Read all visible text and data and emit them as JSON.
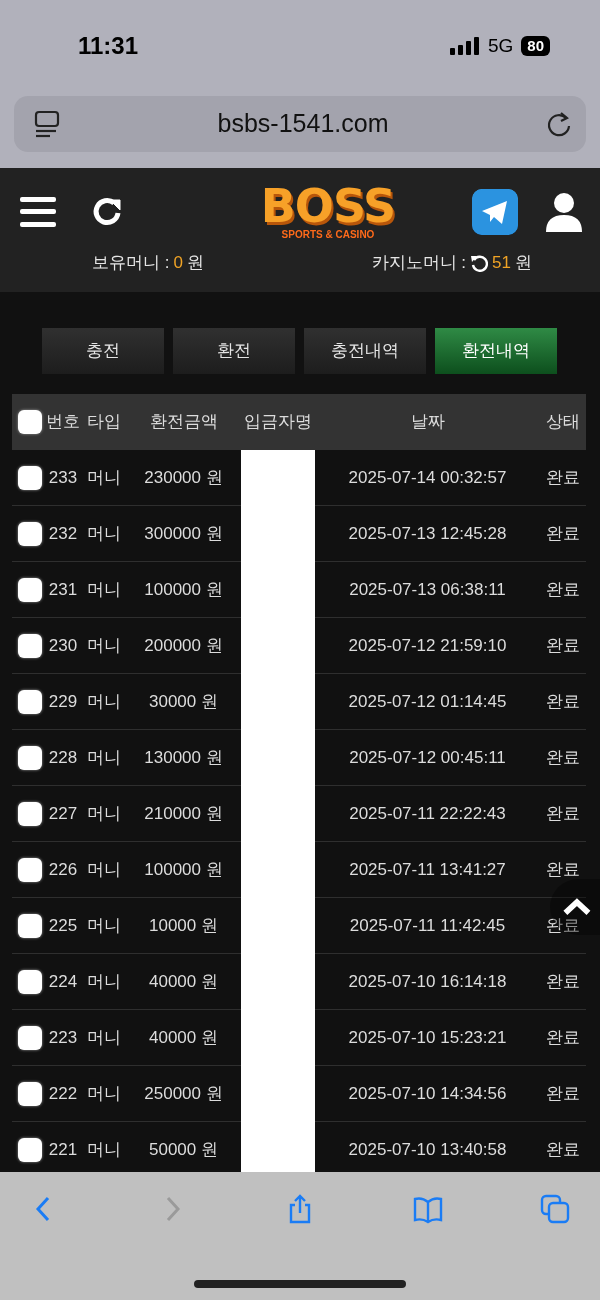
{
  "status_bar": {
    "time": "11:31",
    "network": "5G",
    "battery": "80"
  },
  "browser": {
    "url": "bsbs-1541.com"
  },
  "header": {
    "logo": {
      "title": "BOSS",
      "subtitle": "SPORTS & CASINO"
    },
    "balances": [
      {
        "label": "보유머니 :",
        "amount": "0",
        "unit": "원",
        "refresh": false
      },
      {
        "label": "카지노머니 :",
        "amount": "51",
        "unit": "원",
        "refresh": true
      }
    ]
  },
  "tabs": [
    {
      "label": "충전",
      "selected": false
    },
    {
      "label": "환전",
      "selected": false
    },
    {
      "label": "충전내역",
      "selected": false
    },
    {
      "label": "환전내역",
      "selected": true
    }
  ],
  "table": {
    "header_checkbox": {
      "checked": false
    },
    "columns": [
      "번호",
      "타입",
      "환전금액",
      "입금자명",
      "날짜",
      "상태"
    ],
    "rows": [
      {
        "checked": false,
        "number": "233",
        "type": "머니",
        "amount": "230000 원",
        "date": "2025-07-14 00:32:57",
        "status": "완료"
      },
      {
        "checked": false,
        "number": "232",
        "type": "머니",
        "amount": "300000 원",
        "date": "2025-07-13 12:45:28",
        "status": "완료"
      },
      {
        "checked": false,
        "number": "231",
        "type": "머니",
        "amount": "100000 원",
        "date": "2025-07-13 06:38:11",
        "status": "완료"
      },
      {
        "checked": false,
        "number": "230",
        "type": "머니",
        "amount": "200000 원",
        "date": "2025-07-12 21:59:10",
        "status": "완료"
      },
      {
        "checked": false,
        "number": "229",
        "type": "머니",
        "amount": "30000 원",
        "date": "2025-07-12 01:14:45",
        "status": "완료"
      },
      {
        "checked": false,
        "number": "228",
        "type": "머니",
        "amount": "130000 원",
        "date": "2025-07-12 00:45:11",
        "status": "완료"
      },
      {
        "checked": false,
        "number": "227",
        "type": "머니",
        "amount": "210000 원",
        "date": "2025-07-11 22:22:43",
        "status": "완료"
      },
      {
        "checked": false,
        "number": "226",
        "type": "머니",
        "amount": "100000 원",
        "date": "2025-07-11 13:41:27",
        "status": "완료"
      },
      {
        "checked": false,
        "number": "225",
        "type": "머니",
        "amount": "10000 원",
        "date": "2025-07-11 11:42:45",
        "status": "완료"
      },
      {
        "checked": false,
        "number": "224",
        "type": "머니",
        "amount": "40000 원",
        "date": "2025-07-10 16:14:18",
        "status": "완료"
      },
      {
        "checked": false,
        "number": "223",
        "type": "머니",
        "amount": "40000 원",
        "date": "2025-07-10 15:23:21",
        "status": "완료"
      },
      {
        "checked": false,
        "number": "222",
        "type": "머니",
        "amount": "250000 원",
        "date": "2025-07-10 14:34:56",
        "status": "완료"
      },
      {
        "checked": false,
        "number": "221",
        "type": "머니",
        "amount": "50000 원",
        "date": "2025-07-10 13:40:58",
        "status": "완료"
      }
    ]
  },
  "toolbar": [
    {
      "kind": "back",
      "disabled": false
    },
    {
      "kind": "forward",
      "disabled": true
    },
    {
      "kind": "share",
      "disabled": false
    },
    {
      "kind": "bookmarks",
      "disabled": false
    },
    {
      "kind": "tabs",
      "disabled": false
    }
  ]
}
